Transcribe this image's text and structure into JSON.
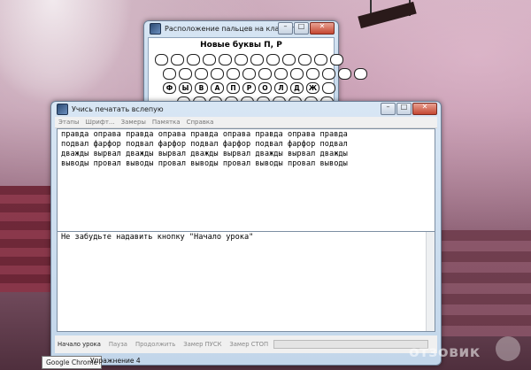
{
  "keyboard_window": {
    "title": "Расположение пальцев на клавиатуре",
    "heading": "Новые буквы П, Р",
    "rows": [
      [
        "",
        "",
        "",
        "",
        "",
        "",
        "",
        "",
        "",
        "",
        "",
        ""
      ],
      [
        "",
        "",
        "",
        "",
        "",
        "",
        "",
        "",
        "",
        "",
        "",
        "",
        ""
      ],
      [
        "Ф",
        "Ы",
        "В",
        "А",
        "П",
        "Р",
        "О",
        "Л",
        "Д",
        "Ж",
        ""
      ],
      [
        "",
        "",
        "",
        "",
        "",
        "",
        "",
        "",
        "",
        ""
      ]
    ]
  },
  "main_window": {
    "title": "Учись печатать вслепую",
    "menu": [
      "Этапы",
      "Шрифт...",
      "Замеры",
      "Памятка",
      "Справка"
    ],
    "lesson_lines": [
      "правда оправа правда оправа правда оправа правда оправа правда",
      "подвал фарфор подвал фарфор подвал фарфор подвал фарфор подвал",
      "дважды вырвал дважды вырвал дважды вырвал дважды вырвал дважды",
      "выводы провал выводы провал выводы провал выводы провал выводы"
    ],
    "hint": "Не забудьте надавить кнопку \"Начало урока\"",
    "buttons": [
      "Начало урока",
      "Пауза",
      "Продолжить",
      "Замер ПУСК",
      "Замер СТОП"
    ]
  },
  "taskbar": {
    "tooltip": "Google Chrome",
    "item": "Упражнение 4"
  },
  "watermark": "отзовик"
}
